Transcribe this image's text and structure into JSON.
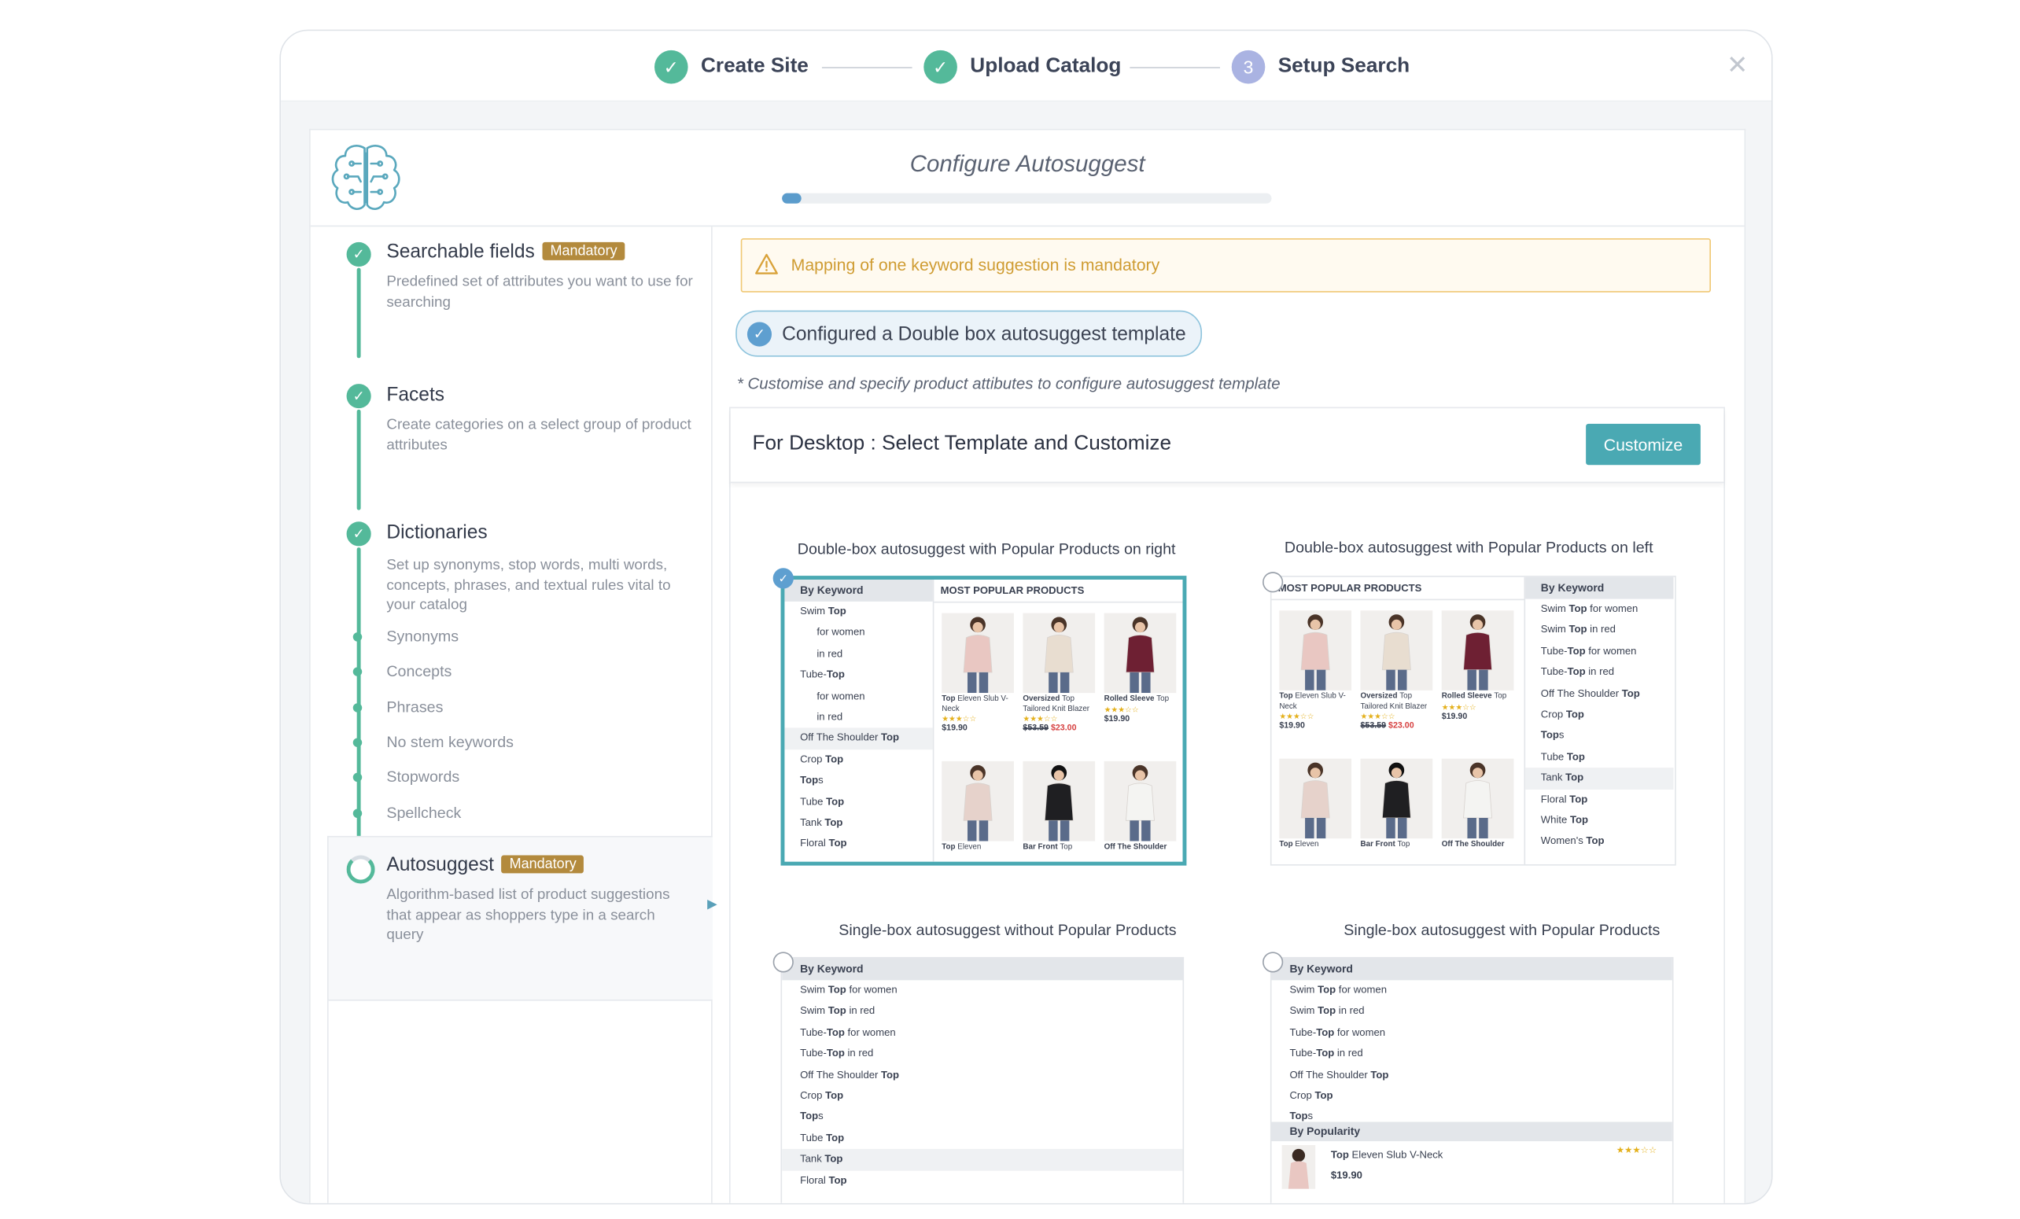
{
  "wizard": {
    "steps": [
      {
        "label": "Create Site",
        "status": "done"
      },
      {
        "label": "Upload Catalog",
        "status": "done"
      },
      {
        "label": "Setup Search",
        "number": "3",
        "status": "current"
      }
    ],
    "close_icon": "close-icon"
  },
  "header": {
    "title": "Configure Autosuggest",
    "progress": 0.04,
    "logo_icon": "brain-icon"
  },
  "sidebar": {
    "sections": [
      {
        "title": "Searchable fields",
        "badge": "Mandatory",
        "desc": "Predefined set of attributes you want to use for searching"
      },
      {
        "title": "Facets",
        "desc": "Create categories on a select group of product attributes"
      },
      {
        "title": "Dictionaries",
        "desc": "Set up synonyms, stop words, multi words, concepts, phrases, and textual rules vital to your catalog"
      },
      {
        "title": "Autosuggest",
        "badge": "Mandatory",
        "desc": "Algorithm-based list of product suggestions that appear as shoppers type in a search query"
      }
    ],
    "dictionary_items": [
      "Synonyms",
      "Concepts",
      "Phrases",
      "No stem keywords",
      "Stopwords",
      "Spellcheck"
    ]
  },
  "main": {
    "warning": "Mapping of one keyword suggestion is mandatory",
    "configured": "Configured a Double box autosuggest template",
    "note": "* Customise and specify product attibutes to configure autosuggest template",
    "panel_title": "For Desktop : Select Template and Customize",
    "customize_label": "Customize",
    "templates": [
      {
        "caption": "Double-box autosuggest with Popular Products on right",
        "selected": true
      },
      {
        "caption": "Double-box autosuggest with Popular Products on left",
        "selected": false
      },
      {
        "caption": "Single-box autosuggest without Popular Products",
        "selected": false
      },
      {
        "caption": "Single-box autosuggest with Popular Products",
        "selected": false
      }
    ]
  },
  "preview": {
    "by_keyword": "By Keyword",
    "most_popular": "MOST POPULAR PRODUCTS",
    "by_popularity": "By Popularity",
    "kw_right": [
      {
        "a": "Swim ",
        "b": "Top",
        "c": ""
      },
      {
        "a": "for women",
        "b": "",
        "c": "",
        "ind": true
      },
      {
        "a": "in red",
        "b": "",
        "c": "",
        "ind": true
      },
      {
        "a": "Tube-",
        "b": "Top",
        "c": ""
      },
      {
        "a": "for women",
        "b": "",
        "c": "",
        "ind": true
      },
      {
        "a": "in red",
        "b": "",
        "c": "",
        "ind": true
      },
      {
        "a": "Off The Shoulder ",
        "b": "Top",
        "c": "",
        "hl": true
      },
      {
        "a": "Crop ",
        "b": "Top",
        "c": ""
      },
      {
        "a": "",
        "b": "Top",
        "c": "s"
      },
      {
        "a": "Tube ",
        "b": "Top",
        "c": ""
      },
      {
        "a": "Tank ",
        "b": "Top",
        "c": ""
      },
      {
        "a": "Floral ",
        "b": "Top",
        "c": ""
      }
    ],
    "kw_left": [
      {
        "a": "Swim ",
        "b": "Top",
        "c": " for women"
      },
      {
        "a": "Swim ",
        "b": "Top",
        "c": " in red"
      },
      {
        "a": "Tube-",
        "b": "Top",
        "c": " for women"
      },
      {
        "a": "Tube-",
        "b": "Top",
        "c": " in red"
      },
      {
        "a": "Off The Shoulder ",
        "b": "Top",
        "c": ""
      },
      {
        "a": "Crop ",
        "b": "Top",
        "c": ""
      },
      {
        "a": "",
        "b": "Top",
        "c": "s"
      },
      {
        "a": "Tube ",
        "b": "Top",
        "c": ""
      },
      {
        "a": "Tank ",
        "b": "Top",
        "c": "",
        "hl": true
      },
      {
        "a": "Floral ",
        "b": "Top",
        "c": ""
      },
      {
        "a": "White ",
        "b": "Top",
        "c": ""
      },
      {
        "a": "Women's ",
        "b": "Top",
        "c": ""
      }
    ],
    "kw_single": [
      {
        "a": "Swim ",
        "b": "Top",
        "c": " for women"
      },
      {
        "a": "Swim ",
        "b": "Top",
        "c": " in red"
      },
      {
        "a": "Tube-",
        "b": "Top",
        "c": " for women"
      },
      {
        "a": "Tube-",
        "b": "Top",
        "c": " in red"
      },
      {
        "a": "Off The Shoulder ",
        "b": "Top",
        "c": ""
      },
      {
        "a": "Crop ",
        "b": "Top",
        "c": ""
      },
      {
        "a": "",
        "b": "Top",
        "c": "s"
      },
      {
        "a": "Tube ",
        "b": "Top",
        "c": ""
      },
      {
        "a": "Tank ",
        "b": "Top",
        "c": "",
        "hl": true
      },
      {
        "a": "Floral ",
        "b": "Top",
        "c": ""
      }
    ],
    "kw_single2": [
      {
        "a": "Swim ",
        "b": "Top",
        "c": " for women"
      },
      {
        "a": "Swim ",
        "b": "Top",
        "c": " in red"
      },
      {
        "a": "Tube-",
        "b": "Top",
        "c": " for women"
      },
      {
        "a": "Tube-",
        "b": "Top",
        "c": " in red"
      },
      {
        "a": "Off The Shoulder ",
        "b": "Top",
        "c": ""
      },
      {
        "a": "Crop ",
        "b": "Top",
        "c": ""
      },
      {
        "a": "",
        "b": "Top",
        "c": "s"
      }
    ],
    "products": [
      {
        "name_a": "Top",
        "name_b": " Eleven Slub V-Neck",
        "stars": "★★★☆☆",
        "old": "",
        "price": "$19.90",
        "color": "#e9c7c2"
      },
      {
        "name_a": "Oversized ",
        "name_b": "Top Tailored Knit Blazer",
        "stars": "★★★☆☆",
        "old": "$53.59",
        "price": "$23.00",
        "color": "#e8ddd0"
      },
      {
        "name_a": "Rolled Sleeve ",
        "name_b": "Top",
        "stars": "★★★☆☆",
        "old": "",
        "price": "$19.90",
        "color": "#6e2033"
      },
      {
        "name_a": "Top",
        "name_b": " Eleven",
        "stars": "",
        "old": "",
        "price": "",
        "color": "#e6d2cb"
      },
      {
        "name_a": "Bar Front ",
        "name_b": "Top",
        "stars": "",
        "old": "",
        "price": "",
        "color": "#1f1f22"
      },
      {
        "name_a": "Off The Shoulder",
        "name_b": "",
        "stars": "",
        "old": "",
        "price": "",
        "color": "#f4f4f2"
      }
    ],
    "popularity_item": {
      "name_a": "Top",
      "name_b": " Eleven Slub V-Neck",
      "stars": "★★★☆☆",
      "price": "$19.90"
    }
  }
}
